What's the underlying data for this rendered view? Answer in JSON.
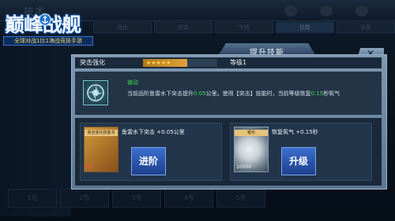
{
  "background": {
    "back_title": "技术",
    "tabs": [
      "强化",
      "改装",
      "专精",
      "技能",
      "装备"
    ],
    "active_tab_index": 3,
    "bottom_slots": [
      "1号",
      "2号",
      "3号",
      "4号",
      "5号"
    ]
  },
  "logo": {
    "title": "巅峰战舰",
    "subtitle": "全球对战1比1海战竞技手游"
  },
  "dialog": {
    "title": "提升技能",
    "close_label": "✕",
    "skill_name": "突击强化",
    "stars": "★★★★★",
    "stars_fraction": 0.6,
    "level_label": "等级1",
    "passive_label": "被动",
    "desc_parts": {
      "p1": "当前品阶鱼雷水下突击提升",
      "v1": "0.05",
      "p2": "公里。使用【突击】技能时，当前等级恢复",
      "v2": "0.15",
      "p3": "秒氧气"
    },
    "left_card": {
      "item_tag": "突击强化技能书",
      "item_count": "0/1",
      "effect": "鱼雷水下突击 +0.05公里",
      "button": "进阶"
    },
    "right_card": {
      "item_tag": "银币",
      "item_count": "10000",
      "effect": "恢复氧气 +0.15秒",
      "button": "升级"
    }
  },
  "colors": {
    "accent": "#3a6fcf",
    "highlight": "#3ddb53",
    "warning": "#ff4b4b"
  }
}
